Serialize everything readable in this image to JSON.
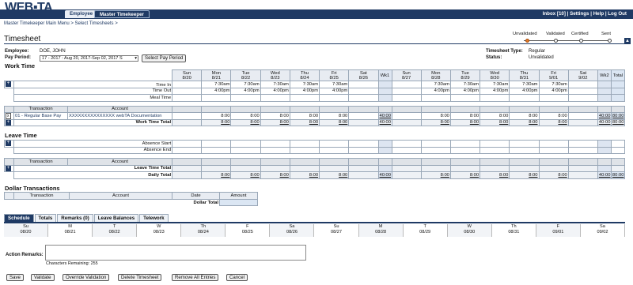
{
  "app": {
    "logo_left": "WEB",
    "logo_right": "TA"
  },
  "tabs": [
    "Employee",
    "Master Timekeeper"
  ],
  "toplinks": [
    "Inbox [10]",
    "Settings",
    "Help",
    "Log Out"
  ],
  "breadcrumb": "Master Timekeeper Main Menu > Select Timesheets >",
  "page_title": "Timesheet",
  "status_steps": [
    "Unvalidated",
    "Validated",
    "Certified",
    "Sent"
  ],
  "employee": {
    "label": "Employee:",
    "name": "DOE, JOHN",
    "pay_period_label": "Pay Period:",
    "pay_period": "17 - 2017 : Aug 20, 2017-Sep 02, 2017 S",
    "select_btn": "Select Pay Period"
  },
  "sheet": {
    "type_label": "Timesheet Type:",
    "type": "Regular",
    "status_label": "Status:",
    "status": "Unvalidated"
  },
  "work_time": {
    "title": "Work Time",
    "days": [
      [
        "Sun",
        "8/20"
      ],
      [
        "Mon",
        "8/21"
      ],
      [
        "Tue",
        "8/22"
      ],
      [
        "Wed",
        "8/23"
      ],
      [
        "Thu",
        "8/24"
      ],
      [
        "Fri",
        "8/25"
      ],
      [
        "Sat",
        "8/26"
      ],
      [
        "Wk1",
        ""
      ],
      [
        "Sun",
        "8/27"
      ],
      [
        "Mon",
        "8/28"
      ],
      [
        "Tue",
        "8/29"
      ],
      [
        "Wed",
        "8/30"
      ],
      [
        "Thu",
        "8/31"
      ],
      [
        "Fri",
        "9/01"
      ],
      [
        "Sat",
        "9/02"
      ],
      [
        "Wk2",
        ""
      ],
      [
        "Total",
        ""
      ]
    ],
    "time_in_label": "Time In",
    "time_out_label": "Time Out",
    "meal_label": "Meal Time",
    "time_in": [
      "",
      "7:30am",
      "7:30am",
      "7:30am",
      "7:30am",
      "7:30am",
      "",
      "",
      "",
      "7:30am",
      "7:30am",
      "7:30am",
      "7:30am",
      "7:30am",
      "",
      "",
      ""
    ],
    "time_out": [
      "",
      "4:00pm",
      "4:00pm",
      "4:00pm",
      "4:00pm",
      "4:00pm",
      "",
      "",
      "",
      "4:00pm",
      "4:00pm",
      "4:00pm",
      "4:00pm",
      "4:00pm",
      "",
      "",
      ""
    ],
    "transaction_header": "Transaction",
    "account_header": "Account",
    "row_transaction": "01 - Regular Base Pay",
    "row_account": "XXXXXXXXXXXXXXX webTA Documentation",
    "row_values": [
      "",
      "8:00",
      "8:00",
      "8:00",
      "8:00",
      "8:00",
      "",
      "40:00",
      "",
      "8:00",
      "8:00",
      "8:00",
      "8:00",
      "8:00",
      "",
      "40:00",
      "80:00"
    ],
    "total_label": "Work Time Total",
    "total_values": [
      "",
      "8:00",
      "8:00",
      "8:00",
      "8:00",
      "8:00",
      "",
      "40:00",
      "",
      "8:00",
      "8:00",
      "8:00",
      "8:00",
      "8:00",
      "",
      "40:00",
      "80:00"
    ]
  },
  "leave_time": {
    "title": "Leave Time",
    "absence_start": "Absence Start",
    "absence_end": "Absence End",
    "transaction_header": "Transaction",
    "account_header": "Account",
    "leave_total_label": "Leave Time Total",
    "daily_total_label": "Daily Total",
    "daily_values": [
      "",
      "8:00",
      "8:00",
      "8:00",
      "8:00",
      "8:00",
      "",
      "40:00",
      "",
      "8:00",
      "8:00",
      "8:00",
      "8:00",
      "8:00",
      "",
      "40:00",
      "80:00"
    ]
  },
  "dollar": {
    "title": "Dollar Transactions",
    "headers": [
      "Transaction",
      "Account",
      "Date",
      "Amount"
    ],
    "total_label": "Dollar Total"
  },
  "bottom_tabs": [
    "Schedule",
    "Totals",
    "Remarks (0)",
    "Leave Balances",
    "Telework"
  ],
  "schedule": [
    [
      "Su",
      "08/20"
    ],
    [
      "M",
      "08/21"
    ],
    [
      "T",
      "08/22"
    ],
    [
      "W",
      "08/23"
    ],
    [
      "Th",
      "08/24"
    ],
    [
      "F",
      "08/25"
    ],
    [
      "Sa",
      "08/26"
    ],
    [
      "Su",
      "08/27"
    ],
    [
      "M",
      "08/28"
    ],
    [
      "T",
      "08/29"
    ],
    [
      "W",
      "08/30"
    ],
    [
      "Th",
      "08/31"
    ],
    [
      "F",
      "09/01"
    ],
    [
      "Sa",
      "09/02"
    ]
  ],
  "remarks": {
    "label": "Action Remarks:",
    "remaining": "Characters Remaining: 255"
  },
  "buttons": [
    "Save",
    "Validate",
    "Override Validation",
    "Delete Timesheet",
    "Remove All Entries",
    "Cancel"
  ],
  "colors": {
    "navy": "#1f3a64",
    "status_active": "#e07a28"
  }
}
